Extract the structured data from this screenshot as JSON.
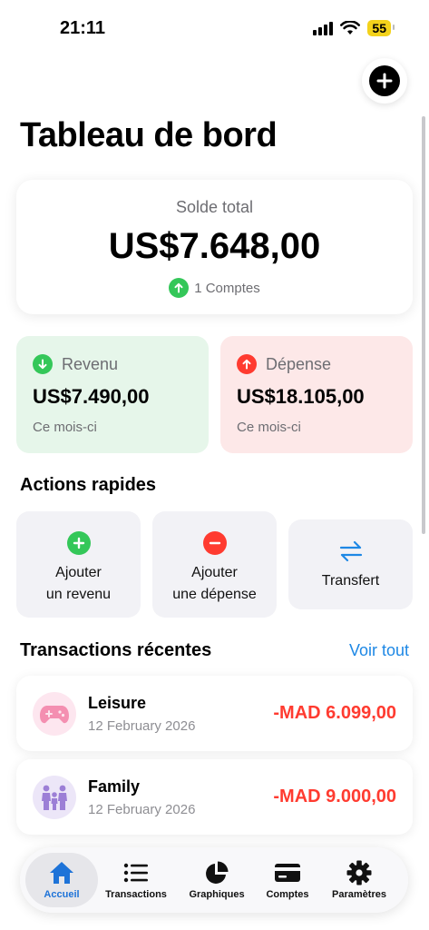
{
  "status_bar": {
    "time": "21:11",
    "battery": "55"
  },
  "header": {
    "title": "Tableau de bord"
  },
  "balance": {
    "label": "Solde total",
    "amount": "US$7.648,00",
    "accounts": "1 Comptes"
  },
  "stats": {
    "income": {
      "label": "Revenu",
      "amount": "US$7.490,00",
      "period": "Ce mois-ci"
    },
    "expense": {
      "label": "Dépense",
      "amount": "US$18.105,00",
      "period": "Ce mois-ci"
    }
  },
  "quick_actions": {
    "title": "Actions rapides",
    "add_income": {
      "line1": "Ajouter",
      "line2": "un revenu"
    },
    "add_expense": {
      "line1": "Ajouter",
      "line2": "une dépense"
    },
    "transfer": {
      "label": "Transfert"
    }
  },
  "recent": {
    "title": "Transactions récentes",
    "see_all": "Voir tout",
    "items": [
      {
        "name": "Leisure",
        "date": "12 February 2026",
        "amount": "-MAD 6.099,00",
        "icon": "gamepad-icon"
      },
      {
        "name": "Family",
        "date": "12 February 2026",
        "amount": "-MAD 9.000,00",
        "icon": "family-icon"
      }
    ]
  },
  "tab_bar": {
    "items": [
      {
        "label": "Accueil",
        "icon": "house-icon",
        "active": true
      },
      {
        "label": "Transactions",
        "icon": "list-icon"
      },
      {
        "label": "Graphiques",
        "icon": "pie-chart-icon"
      },
      {
        "label": "Comptes",
        "icon": "card-icon"
      },
      {
        "label": "Paramètres",
        "icon": "gear-icon"
      }
    ]
  },
  "colors": {
    "accent": "#1e88e5",
    "income": "#34c759",
    "expense": "#ff3b30"
  }
}
